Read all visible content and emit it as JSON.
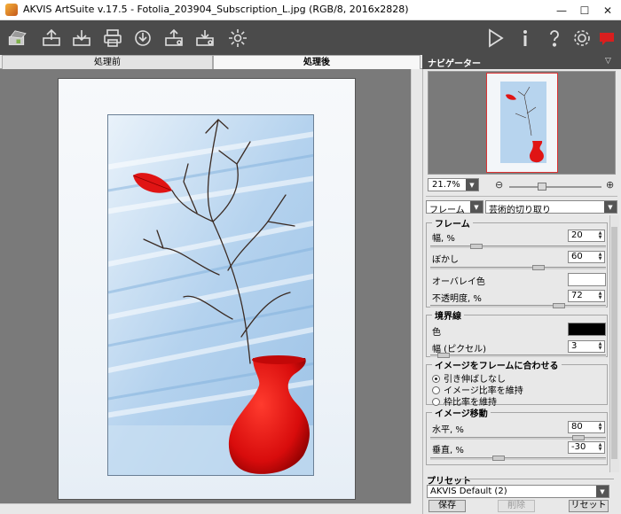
{
  "window": {
    "title": "AKVIS ArtSuite v.17.5 - Fotolia_203904_Subscription_L.jpg (RGB/8, 2016x2828)",
    "minimize": "—",
    "maximize": "☐",
    "close": "✕"
  },
  "toolbar": {
    "left_icons": [
      "home-icon",
      "open-icon",
      "save-icon",
      "print-icon",
      "import-icon",
      "export-icon",
      "share-icon",
      "settings-gear-icon"
    ],
    "right_icons": [
      "run-icon",
      "info-icon",
      "help-icon",
      "preferences-icon",
      "feedback-icon"
    ]
  },
  "tabs": {
    "before": "処理前",
    "after": "処理後"
  },
  "navigator": {
    "title": "ナビゲーター",
    "zoom_value": "21.7%",
    "minus": "⊖",
    "plus": "⊕"
  },
  "effect": {
    "category": "フレーム",
    "type": "芸術的切り取り"
  },
  "frame_group": {
    "title": "フレーム",
    "width_label": "幅, %",
    "width_value": "20",
    "blur_label": "ぼかし",
    "blur_value": "60",
    "overlay_label": "オーバレイ色",
    "overlay_color": "#ffffff",
    "opacity_label": "不透明度, %",
    "opacity_value": "72"
  },
  "border_group": {
    "title": "境界線",
    "color_label": "色",
    "color": "#000000",
    "width_label": "幅 (ピクセル)",
    "width_value": "3"
  },
  "fit_group": {
    "title": "イメージをフレームに合わせる",
    "options": [
      "引き伸ばしなし",
      "イメージ比率を維持",
      "枠比率を維持"
    ],
    "selected_index": 0
  },
  "move_group": {
    "title": "イメージ移動",
    "horizontal_label": "水平, %",
    "horizontal_value": "80",
    "vertical_label": "垂直, %",
    "vertical_value": "-30"
  },
  "presets": {
    "title": "プリセット",
    "selected": "AKVIS Default (2)",
    "save": "保存",
    "delete": "削除",
    "reset": "リセット"
  },
  "colors": {
    "toolbar_bg": "#4b4b4b",
    "canvas_bg": "#7a7a7a",
    "vase_red": "#e01414",
    "feedback_red": "#d91e1e"
  }
}
